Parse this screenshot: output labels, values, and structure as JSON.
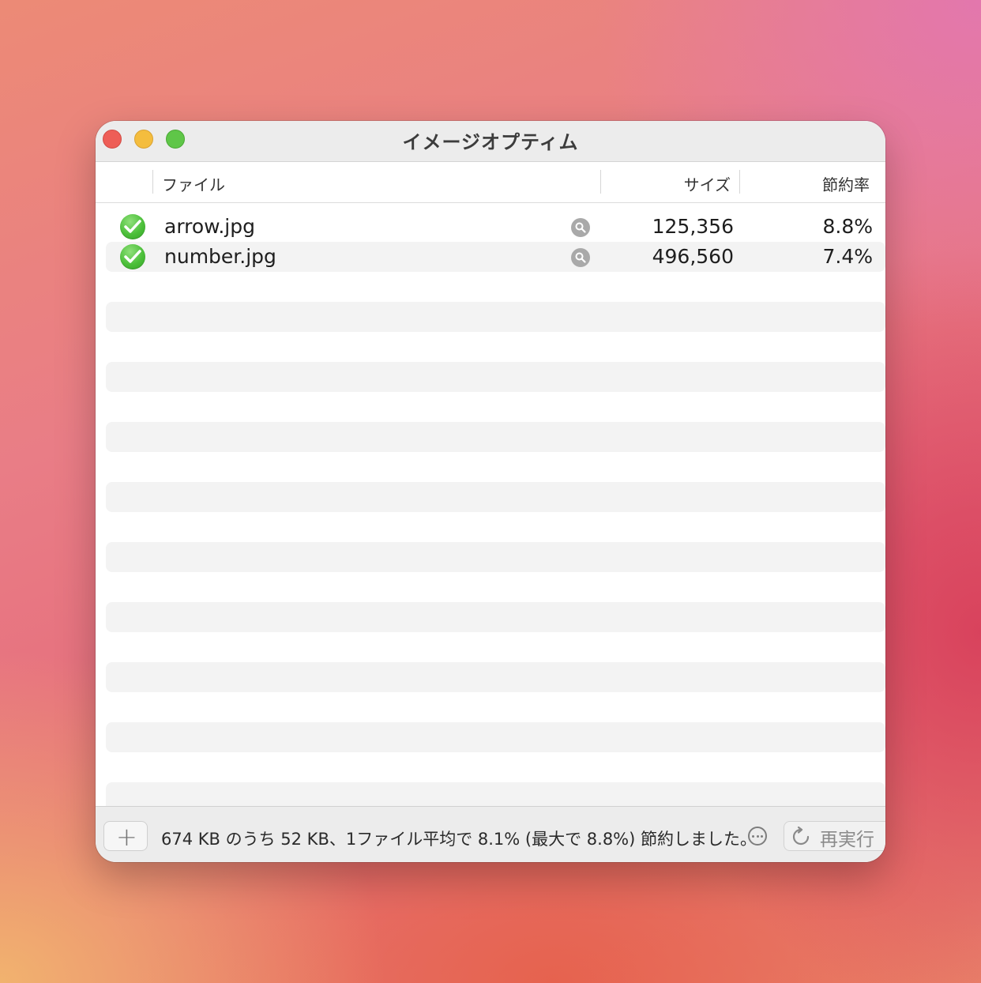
{
  "window": {
    "title": "イメージオプティム",
    "traffic_lights": [
      "close",
      "minimize",
      "zoom"
    ]
  },
  "columns": {
    "file": "ファイル",
    "size": "サイズ",
    "savings": "節約率"
  },
  "files": [
    {
      "status_icon": "checkmark-icon",
      "name": "arrow.jpg",
      "size": "125,356",
      "savings": "8.8%"
    },
    {
      "status_icon": "checkmark-icon",
      "name": "number.jpg",
      "size": "496,560",
      "savings": "7.4%"
    }
  ],
  "footer": {
    "add_label": "+",
    "status_text": "674 KB のうち 52 KB、1ファイル平均で 8.1% (最大で 8.8%) 節約しました。",
    "rerun_label": "再実行"
  },
  "colors": {
    "success": "#4cbf3a",
    "close": "#ee5e57",
    "minimize": "#f4bd3e",
    "zoom": "#5fc648"
  }
}
